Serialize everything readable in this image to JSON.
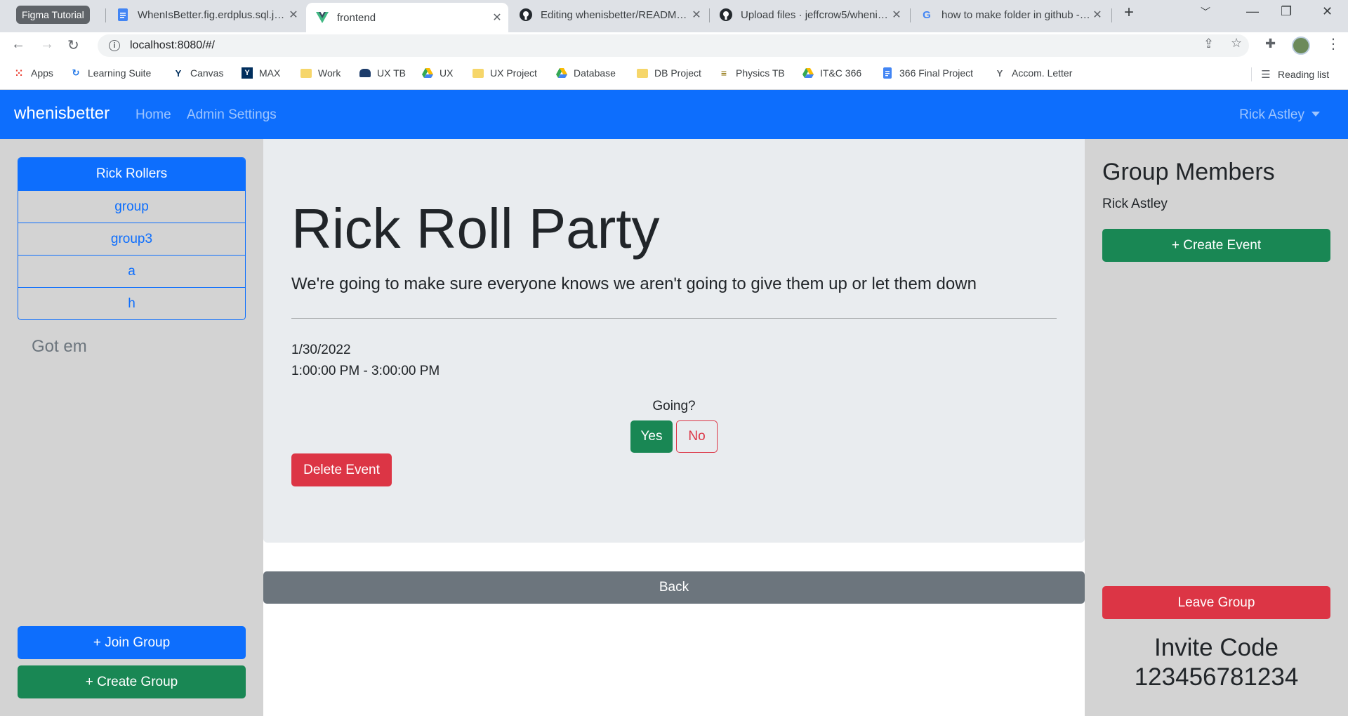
{
  "browser": {
    "tab_group": "Figma Tutorial",
    "tabs": [
      {
        "title": "WhenIsBetter.fig.erdplus.sql.json",
        "icon": "docs-icon"
      },
      {
        "title": "frontend",
        "icon": "vue-icon"
      },
      {
        "title": "Editing whenisbetter/README.md",
        "icon": "github-icon"
      },
      {
        "title": "Upload files · jeffcrow5/whenisbetter",
        "icon": "github-icon"
      },
      {
        "title": "how to make folder in github - Google Search",
        "icon": "google-icon"
      }
    ],
    "url": "localhost:8080/#/",
    "bookmarks": [
      "Apps",
      "Learning Suite",
      "Canvas",
      "MAX",
      "Work",
      "UX TB",
      "UX",
      "UX Project",
      "Database",
      "DB Project",
      "Physics TB",
      "IT&C 366",
      "366 Final Project",
      "Accom. Letter"
    ],
    "reading_list": "Reading list"
  },
  "navbar": {
    "brand": "whenisbetter",
    "links": [
      "Home",
      "Admin Settings"
    ],
    "user": "Rick Astley"
  },
  "sidebar": {
    "groups": [
      "Rick Rollers",
      "group",
      "group3",
      "a",
      "h"
    ],
    "note": "Got em",
    "join_label": "+ Join Group",
    "create_label": "+ Create Group"
  },
  "event": {
    "title": "Rick Roll Party",
    "description": "We're going to make sure everyone knows we aren't going to give them up or let them down",
    "date": "1/30/2022",
    "time": "1:00:00 PM - 3:00:00 PM",
    "going_label": "Going?",
    "yes_label": "Yes",
    "no_label": "No",
    "delete_label": "Delete Event",
    "back_label": "Back"
  },
  "members": {
    "title": "Group Members",
    "list": [
      "Rick Astley"
    ],
    "create_event_label": "+ Create Event",
    "leave_label": "Leave Group",
    "invite_label": "Invite Code",
    "invite_code": "123456781234"
  },
  "colors": {
    "primary": "#0d6efd",
    "success": "#198754",
    "danger": "#dc3545",
    "secondary": "#6c757d",
    "sidebar_bg": "#d3d3d3",
    "jumbotron_bg": "#e9ecef"
  }
}
